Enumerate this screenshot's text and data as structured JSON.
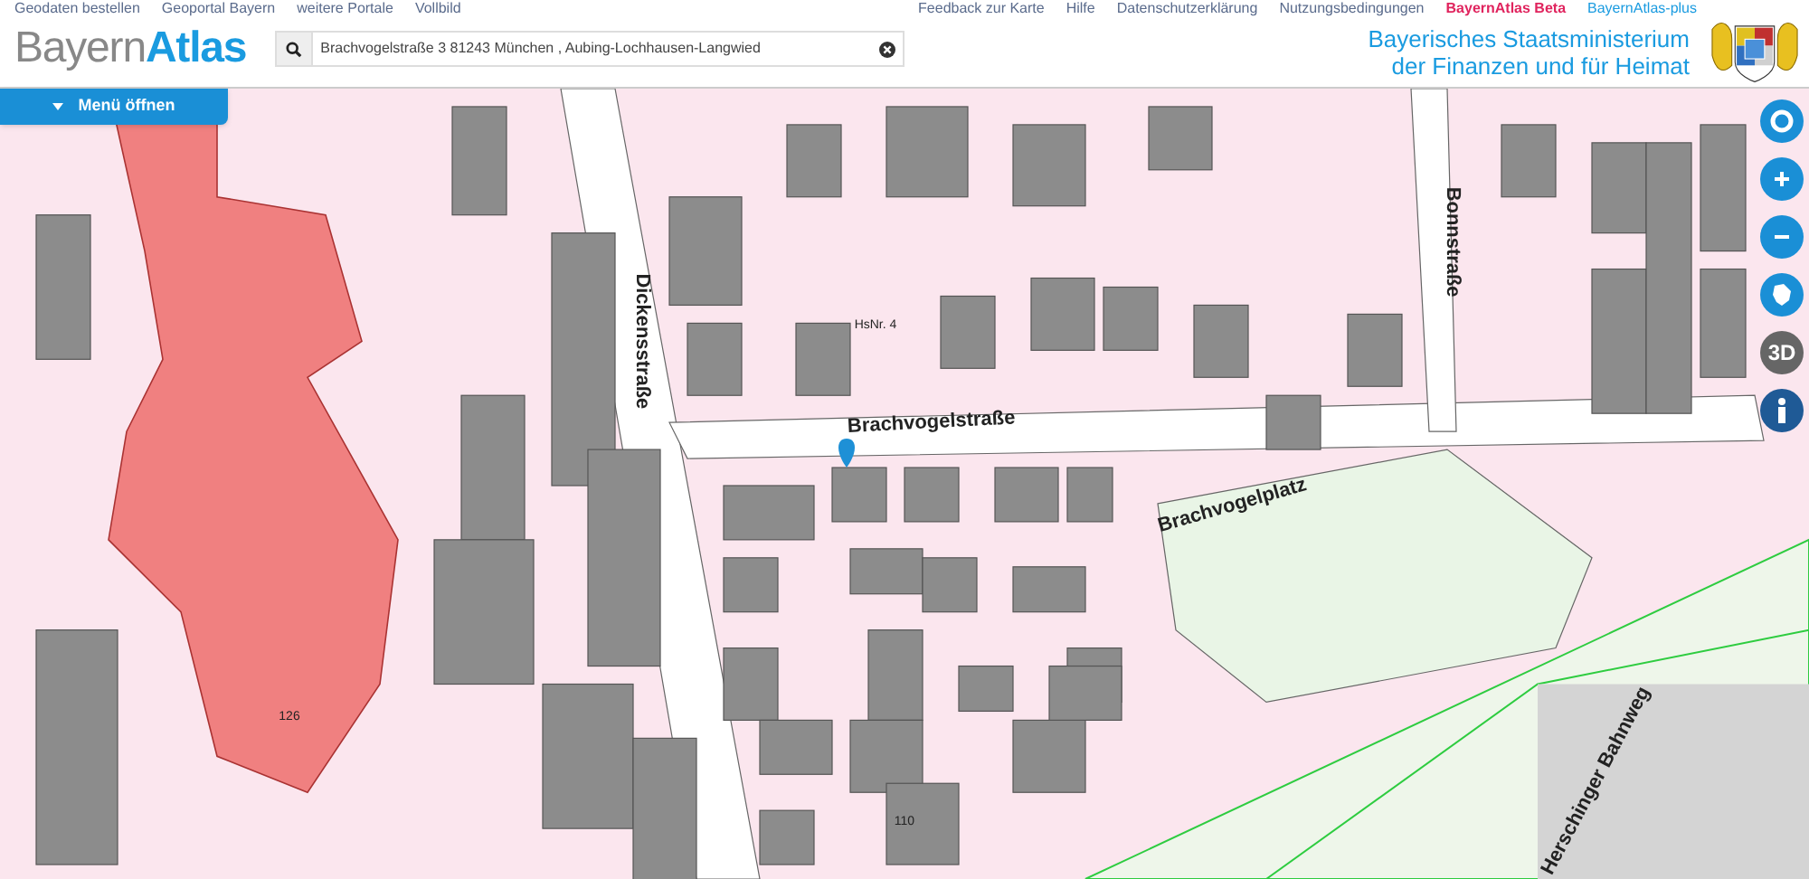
{
  "top_links_left": [
    "Geodaten bestellen",
    "Geoportal Bayern",
    "weitere Portale",
    "Vollbild"
  ],
  "top_links_right": [
    {
      "text": "Feedback zur Karte",
      "kind": "normal"
    },
    {
      "text": "Hilfe",
      "kind": "normal"
    },
    {
      "text": "Datenschutzerklärung",
      "kind": "normal"
    },
    {
      "text": "Nutzungsbedingungen",
      "kind": "normal"
    },
    {
      "text": "BayernAtlas Beta",
      "kind": "highlight"
    },
    {
      "text": "BayernAtlas-plus",
      "kind": "plus"
    }
  ],
  "logo": {
    "part_1": "Bayern",
    "part_2": "Atlas"
  },
  "search": {
    "value": "Brachvogelstraße 3 81243 München , Aubing-Lochhausen-Langwied"
  },
  "ministry": [
    "Bayerisches Staatsministerium",
    "der Finanzen und für Heimat"
  ],
  "menu_button": "Menü öffnen",
  "map": {
    "labels": [
      {
        "text": "Dickensstraße",
        "kind": "street"
      },
      {
        "text": "Brachvogelstraße",
        "kind": "street"
      },
      {
        "text": "Brachvogelplatz",
        "kind": "street"
      },
      {
        "text": "Bonnstraße",
        "kind": "street"
      },
      {
        "text": "Herschinger Bahnweg",
        "kind": "street"
      },
      {
        "text": "HsNr. 4",
        "kind": "number"
      },
      {
        "text": "126",
        "kind": "number"
      },
      {
        "text": "110",
        "kind": "number"
      }
    ]
  },
  "map_controls": {
    "three_d": "3D"
  }
}
